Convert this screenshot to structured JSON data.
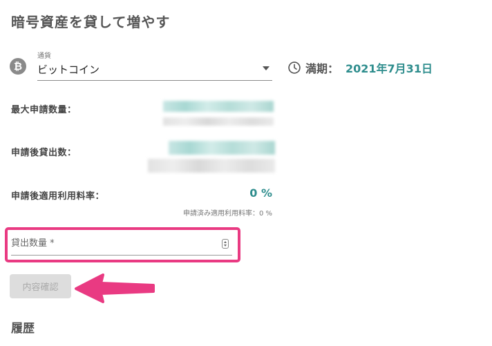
{
  "page": {
    "title": "暗号資産を貸して増やす",
    "history_title": "履歴"
  },
  "currency_select": {
    "label": "通貨",
    "value": "ビットコイン",
    "icon": "bitcoin-icon",
    "icon_glyph": "₿"
  },
  "maturity": {
    "icon": "clock-icon",
    "label": "満期：",
    "date": "2021年7月31日"
  },
  "fields": {
    "max_quantity_label": "最大申請数量：",
    "lent_after_label": "申請後貸出数：",
    "rate_after_label": "申請後適用利用料率：",
    "rate_value": "0 %",
    "rate_applied_note": "申請済み適用利用料率：0 %"
  },
  "amount_input": {
    "placeholder": "貸出数量 *",
    "value": ""
  },
  "confirm_button": {
    "label": "内容確認"
  },
  "colors": {
    "accent": "#2e8d8d",
    "highlight": "#e93a82",
    "button_disabled": "#dddddd"
  }
}
